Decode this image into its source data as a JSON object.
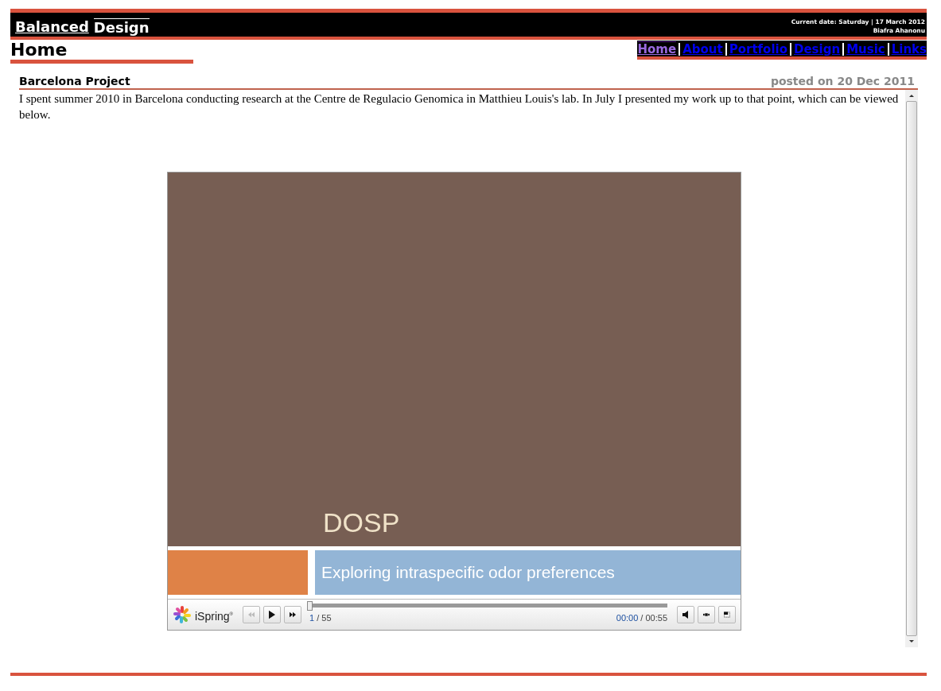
{
  "header": {
    "logo_parts": [
      "Balanced",
      "Design"
    ],
    "date": "Current date: Saturday | 17 March 2012",
    "author": "Biafra Ahanonu"
  },
  "page_title": "Home",
  "nav": [
    {
      "label": "Home",
      "selected": true
    },
    {
      "label": "About",
      "selected": false
    },
    {
      "label": "Portfolio",
      "selected": false
    },
    {
      "label": "Design",
      "selected": false
    },
    {
      "label": "Music",
      "selected": false
    },
    {
      "label": "Links",
      "selected": false
    }
  ],
  "post": {
    "title": "Barcelona Project",
    "posted": "posted on 20 Dec 2011",
    "body": "I spent summer 2010 in Barcelona conducting research at the Centre de Regulacio Genomica in Matthieu Louis's lab. In July I presented my work up to that point, which can be viewed below."
  },
  "player": {
    "slide_title": "DOSP",
    "slide_subtitle": "Exploring intraspecific odor preferences",
    "brand": "iSpring",
    "brand_mark": "®",
    "slide_current": "1",
    "slide_total": "/ 55",
    "time_current": "00:00",
    "time_total": "/ 00:55",
    "progress": {
      "level": 0
    }
  }
}
